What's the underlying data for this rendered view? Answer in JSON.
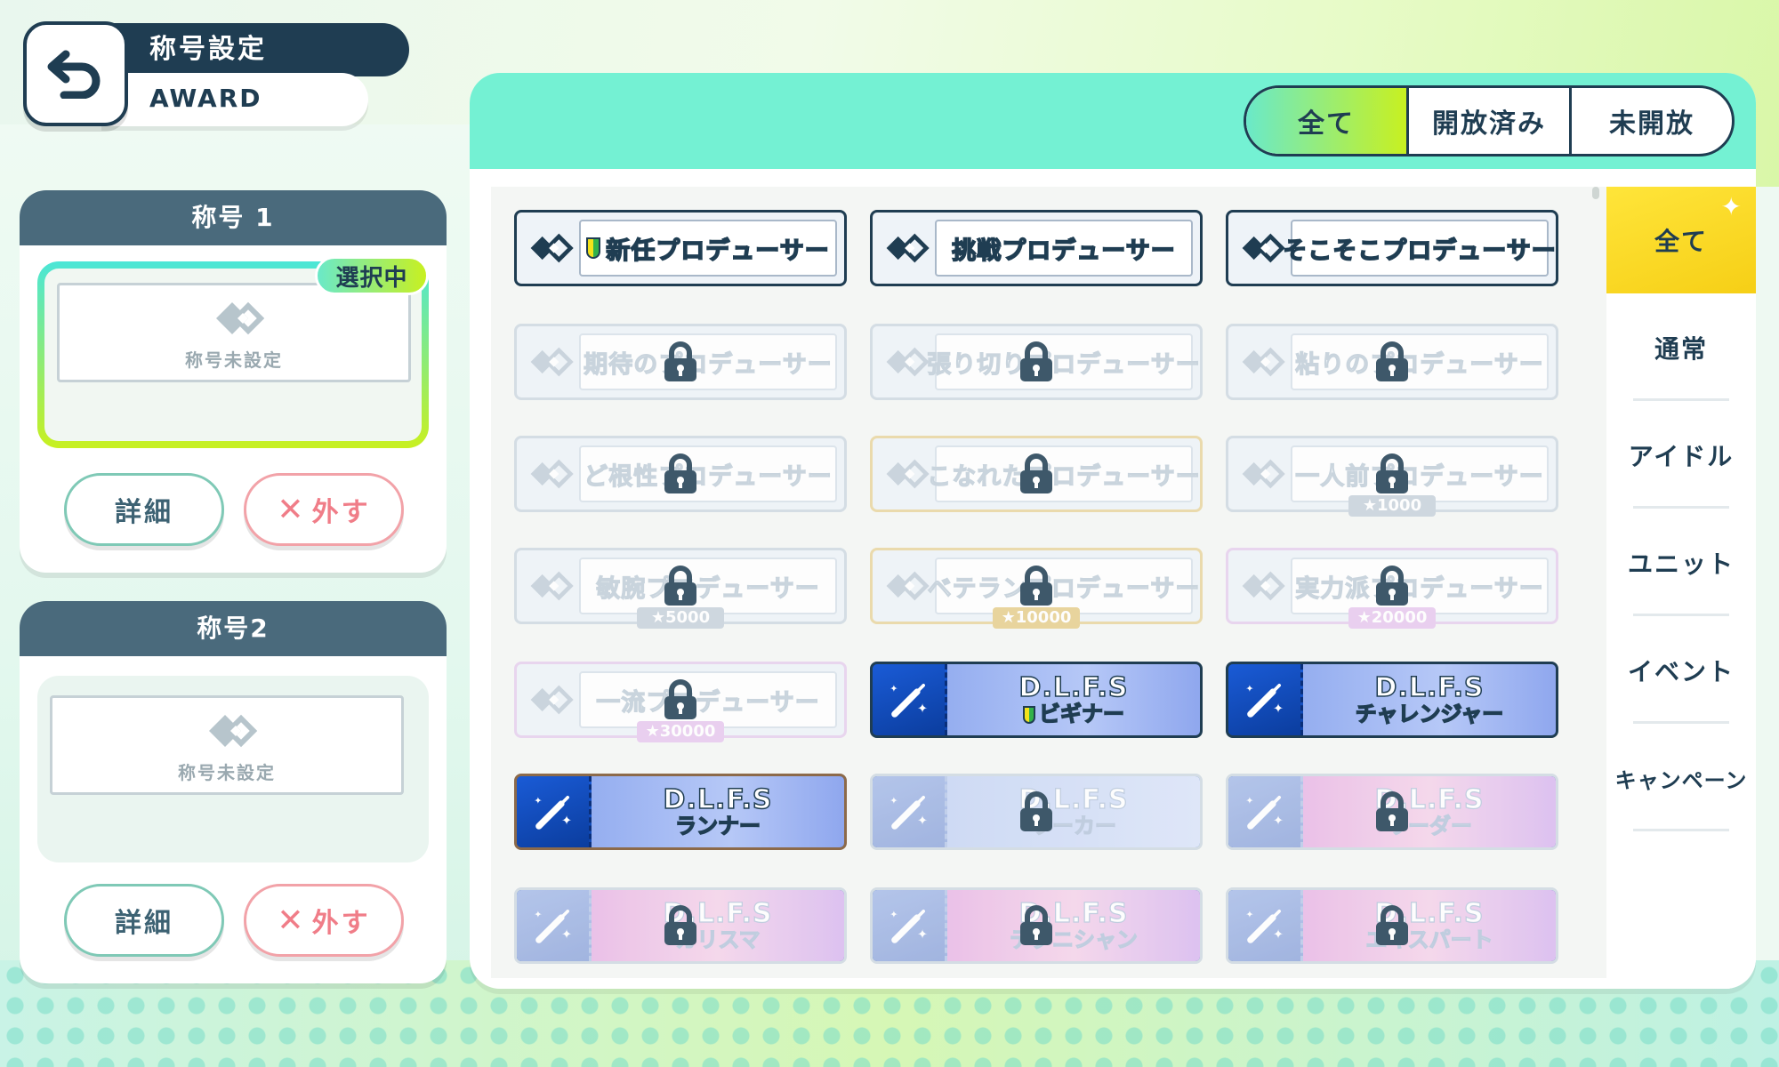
{
  "header": {
    "title": "称号設定",
    "subtitle": "AWARD"
  },
  "slots": [
    {
      "label": "称号 1",
      "empty_text": "称号未設定",
      "selected": true,
      "badge": "選択中",
      "detail_label": "詳細",
      "remove_label": "外す"
    },
    {
      "label": "称号2",
      "empty_text": "称号未設定",
      "selected": false,
      "detail_label": "詳細",
      "remove_label": "外す"
    }
  ],
  "filter_tabs": [
    "全て",
    "開放済み",
    "未開放"
  ],
  "active_filter": "全て",
  "categories": [
    "全て",
    "通常",
    "アイドル",
    "ユニット",
    "イベント",
    "キャンペーン"
  ],
  "active_category": "全て",
  "awards": [
    {
      "type": "title",
      "name": "新任プロデューサー",
      "locked": false,
      "icon": "beginner-leaf-icon"
    },
    {
      "type": "title",
      "name": "挑戦プロデューサー",
      "locked": false
    },
    {
      "type": "title",
      "name": "そこそこプロデューサー",
      "locked": false
    },
    {
      "type": "title",
      "name": "期待のプロデューサー",
      "locked": true
    },
    {
      "type": "title",
      "name": "張り切りプロデューサー",
      "locked": true
    },
    {
      "type": "title",
      "name": "粘りのプロデューサー",
      "locked": true
    },
    {
      "type": "title",
      "name": "ど根性プロデューサー",
      "locked": true
    },
    {
      "type": "title",
      "name": "こなれたプロデューサー",
      "locked": true,
      "tier": "gold"
    },
    {
      "type": "title",
      "name": "一人前プロデューサー",
      "locked": true,
      "requirement": "1000"
    },
    {
      "type": "title",
      "name": "敏腕プロデューサー",
      "locked": true,
      "requirement": "5000"
    },
    {
      "type": "title",
      "name": "ベテランプロデューサー",
      "locked": true,
      "tier": "gold",
      "requirement": "10000"
    },
    {
      "type": "title",
      "name": "実力派プロデューサー",
      "locked": true,
      "tier": "rainbow",
      "requirement": "20000"
    },
    {
      "type": "title",
      "name": "一流プロデューサー",
      "locked": true,
      "tier": "rainbow",
      "requirement": "30000"
    },
    {
      "type": "dlfs",
      "line1": "D.L.F.S",
      "line2": "ビギナー",
      "locked": false,
      "icon": "beginner-leaf-icon"
    },
    {
      "type": "dlfs",
      "line1": "D.L.F.S",
      "line2": "チャレンジャー",
      "locked": false
    },
    {
      "type": "dlfs",
      "line1": "D.L.F.S",
      "line2": "ランナー",
      "locked": false,
      "tier": "copper"
    },
    {
      "type": "dlfs",
      "line1": "D.L.F.S",
      "line2": "ワーカー",
      "locked": true
    },
    {
      "type": "dlfs",
      "line1": "D.L.F.S",
      "line2": "リーダー",
      "locked": true,
      "tier": "pink"
    },
    {
      "type": "dlfs",
      "line1": "D.L.F.S",
      "line2": "カリスマ",
      "locked": true,
      "tier": "pink"
    },
    {
      "type": "dlfs",
      "line1": "D.L.F.S",
      "line2": "テクニシャン",
      "locked": true,
      "tier": "pink"
    },
    {
      "type": "dlfs",
      "line1": "D.L.F.S",
      "line2": "エキスパート",
      "locked": true,
      "tier": "pink"
    }
  ],
  "colors": {
    "navy": "#1f3d52",
    "mint": "#74f1d3",
    "lime": "#c8f020",
    "active_yellow": "#f6cf16",
    "remove_pink": "#f07d88"
  }
}
